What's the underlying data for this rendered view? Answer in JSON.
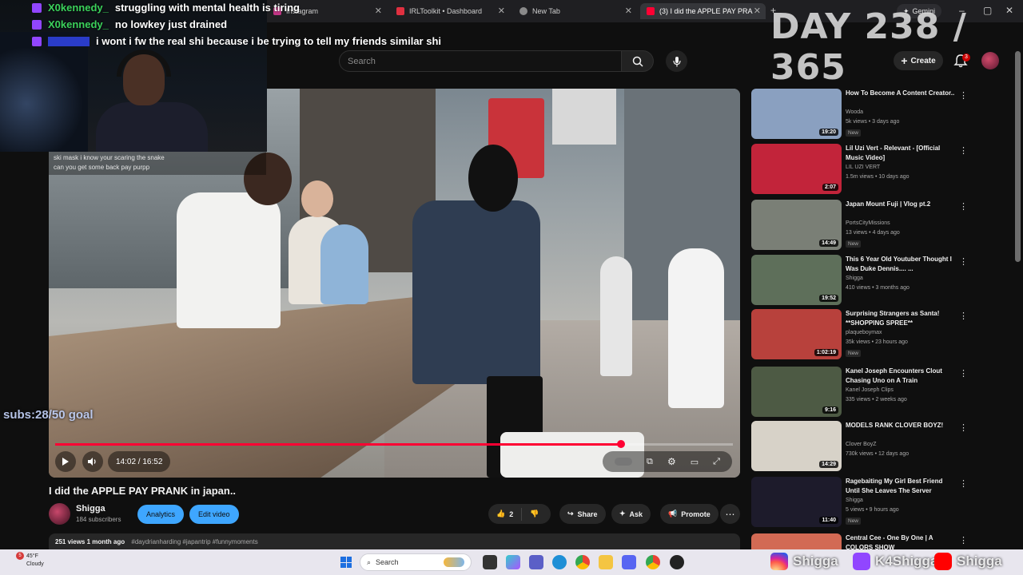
{
  "browser": {
    "tabs": [
      {
        "label": "Instagram",
        "icon": "instagram-icon"
      },
      {
        "label": "IRLToolkit • Dashboard",
        "icon": "irltoolkit-icon"
      },
      {
        "label": "New Tab",
        "icon": "globe-icon"
      },
      {
        "label": "(3) I did the APPLE PAY PRA",
        "icon": "youtube-icon"
      }
    ],
    "gemini_label": "Gemini"
  },
  "overlay": {
    "day_counter": "DAY 238 / 365",
    "subs_goal": "subs:28/50 goal"
  },
  "chat": [
    {
      "name": "X0kennedy_",
      "message": "struggling with mental health is tiring"
    },
    {
      "name": "X0kennedy_",
      "message": "no lowkey just drained"
    },
    {
      "name": "",
      "message": "i wont i fw the real shi because i be trying to tell my friends similar shi"
    }
  ],
  "player_chat": {
    "line1": "ski mask i know your scaring the snake",
    "line2": "can you get some back pay purpp"
  },
  "header": {
    "search_placeholder": "Search",
    "create_label": "Create",
    "notification_count": "3"
  },
  "player": {
    "time": "14:02 / 16:52",
    "progress": 0.835
  },
  "video": {
    "title": "I did the APPLE PAY PRANK in japan..",
    "channel": "Shigga",
    "subscribers": "184 subscribers",
    "analytics_label": "Analytics",
    "edit_label": "Edit video",
    "likes": "2",
    "share_label": "Share",
    "ask_label": "Ask",
    "promote_label": "Promote",
    "views_date": "251 views  1 month ago",
    "hashtags": "#daydrianharding #japantrip #funnymoments"
  },
  "recommendations": [
    {
      "title": "How To Become A Content Creator..",
      "channel": "Wooda",
      "meta": "5k views • 3 days ago",
      "new": "New",
      "duration": "19:20",
      "color": "#8aa0c0"
    },
    {
      "title": "Lil Uzi Vert - Relevant - [Official Music Video]",
      "channel": "LIL UZI VERT",
      "meta": "1.5m views • 10 days ago",
      "new": "",
      "duration": "2:07",
      "color": "#c2243a"
    },
    {
      "title": "Japan Mount Fuji | Vlog pt.2",
      "channel": "PortsCityMissions",
      "meta": "13 views • 4 days ago",
      "new": "New",
      "duration": "14:49",
      "color": "#7a7f76"
    },
    {
      "title": "This 6 Year Old Youtuber Thought I Was Duke Dennis.... ...",
      "channel": "Shigga",
      "meta": "410 views • 3 months ago",
      "new": "",
      "duration": "19:52",
      "color": "#5e6f5a"
    },
    {
      "title": "Surprising Strangers as Santa! **SHOPPING SPREE**",
      "channel": "plaqueboymax",
      "meta": "35k views • 23 hours ago",
      "new": "New",
      "duration": "1:02:19",
      "color": "#b8413c"
    },
    {
      "title": "Kanel Joseph Encounters Clout Chasing Uno on A Train",
      "channel": "Kanel Joseph Clips",
      "meta": "335 views • 2 weeks ago",
      "new": "",
      "duration": "9:16",
      "color": "#4d5a44"
    },
    {
      "title": "MODELS RANK CLOVER BOYZ!",
      "channel": "Clover BoyZ",
      "meta": "730k views • 12 days ago",
      "new": "",
      "duration": "14:29",
      "color": "#d7d2c8"
    },
    {
      "title": "Ragebaiting My Girl Best Friend Until She Leaves The Server",
      "channel": "Shigga",
      "meta": "5 views • 9 hours ago",
      "new": "New",
      "duration": "11:40",
      "color": "#1d1b2b"
    },
    {
      "title": "Central Cee - One By One | A COLORS SHOW",
      "channel": "",
      "meta": "",
      "new": "",
      "duration": "",
      "color": "#d26a54"
    }
  ],
  "taskbar": {
    "temp": "45°F",
    "weather": "Cloudy",
    "search_placeholder": "Search",
    "weather_badge": "5"
  },
  "socials": [
    {
      "handle": "Shigga",
      "icon": "instagram-icon"
    },
    {
      "handle": "K4Shigga",
      "icon": "twitch-icon"
    },
    {
      "handle": "Shigga",
      "icon": "youtube-icon"
    }
  ]
}
